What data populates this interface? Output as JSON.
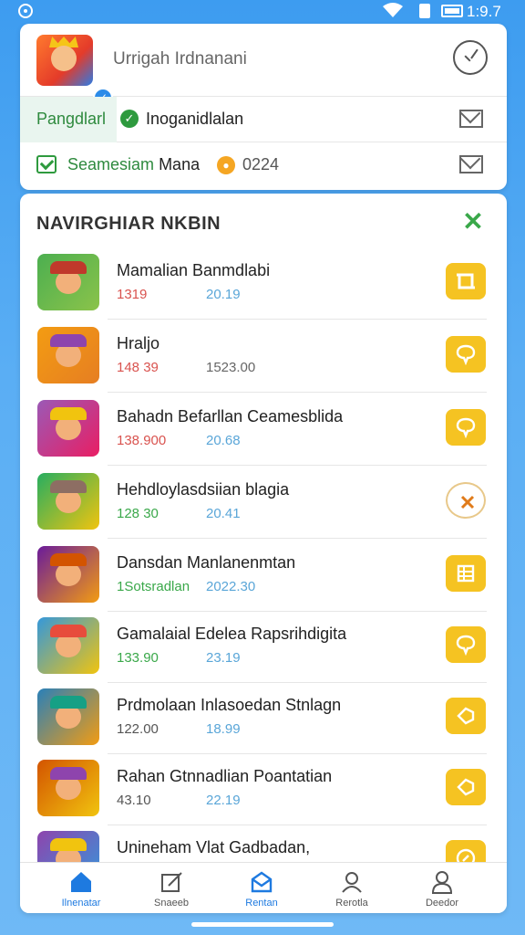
{
  "status_bar": {
    "time": "1:9.7"
  },
  "profile": {
    "name": "Urrigah Irdnanani",
    "tab_label": "Pangdlarl",
    "tab_value": "Inoganidlalan",
    "row2_label": "Seamesiam",
    "row2_label_dark": "Mana",
    "row2_value": "0224"
  },
  "section": {
    "title": "NAVIRGHIAR NKBIN"
  },
  "games": [
    {
      "title": "Mamalian Banmdlabi",
      "stat_a": "1319",
      "stat_b": "20.19",
      "stat_a_color": "#d9534f",
      "button": "crop-icon",
      "btn_style": "filled"
    },
    {
      "title": "Hraljo",
      "stat_a": "148 39",
      "stat_b": "1523.00",
      "stat_a_color": "#d9534f",
      "button": "chat-icon",
      "btn_style": "filled"
    },
    {
      "title": "Bahadn Befarllan Ceamesblida",
      "stat_a": "138.900",
      "stat_b": "20.68",
      "stat_a_color": "#d9534f",
      "button": "chat-icon",
      "btn_style": "filled"
    },
    {
      "title": "Hehdloylasdsiian blagia",
      "stat_a": "128 30",
      "stat_b": "20.41",
      "stat_a_color": "#3aa84a",
      "button": "shuffle-icon",
      "btn_style": "outline"
    },
    {
      "title": "Dansdan Manlanenmtan",
      "stat_a": "1Sotsradlan",
      "stat_b": "2022.30",
      "stat_a_color": "#3aa84a",
      "button": "list-icon",
      "btn_style": "filled"
    },
    {
      "title": "Gamalaial Edelea Rapsrihdigita",
      "stat_a": "133.90",
      "stat_b": "23.19",
      "stat_a_color": "#3aa84a",
      "button": "chat-icon",
      "btn_style": "filled"
    },
    {
      "title": "Prdmolaan Inlasoedan Stnlagn",
      "stat_a": "122.00",
      "stat_b": "18.99",
      "stat_a_color": "#555555",
      "button": "tag-icon",
      "btn_style": "filled"
    },
    {
      "title": "Rahan Gtnnadlian Poantatian",
      "stat_a": "43.10",
      "stat_b": "22.19",
      "stat_a_color": "#555555",
      "button": "tag-icon",
      "btn_style": "filled"
    },
    {
      "title": "Unineham Vlat Gadbadan,",
      "stat_a": "",
      "stat_b": "",
      "stat_a_color": "#555555",
      "button": "compass-icon",
      "btn_style": "filled"
    }
  ],
  "nav": [
    {
      "label": "Ilnenatar",
      "icon": "home-icon",
      "active": true
    },
    {
      "label": "Snaeeb",
      "icon": "edit-icon",
      "active": false
    },
    {
      "label": "Rentan",
      "icon": "mail-icon",
      "active": true
    },
    {
      "label": "Rerotla",
      "icon": "user-swap-icon",
      "active": false
    },
    {
      "label": "Deedor",
      "icon": "profile-icon",
      "active": false
    }
  ],
  "colors": {
    "accent": "#1e7ae0",
    "green": "#3aa84a",
    "button_yellow": "#f5c322",
    "background": "#4aa5f2"
  }
}
